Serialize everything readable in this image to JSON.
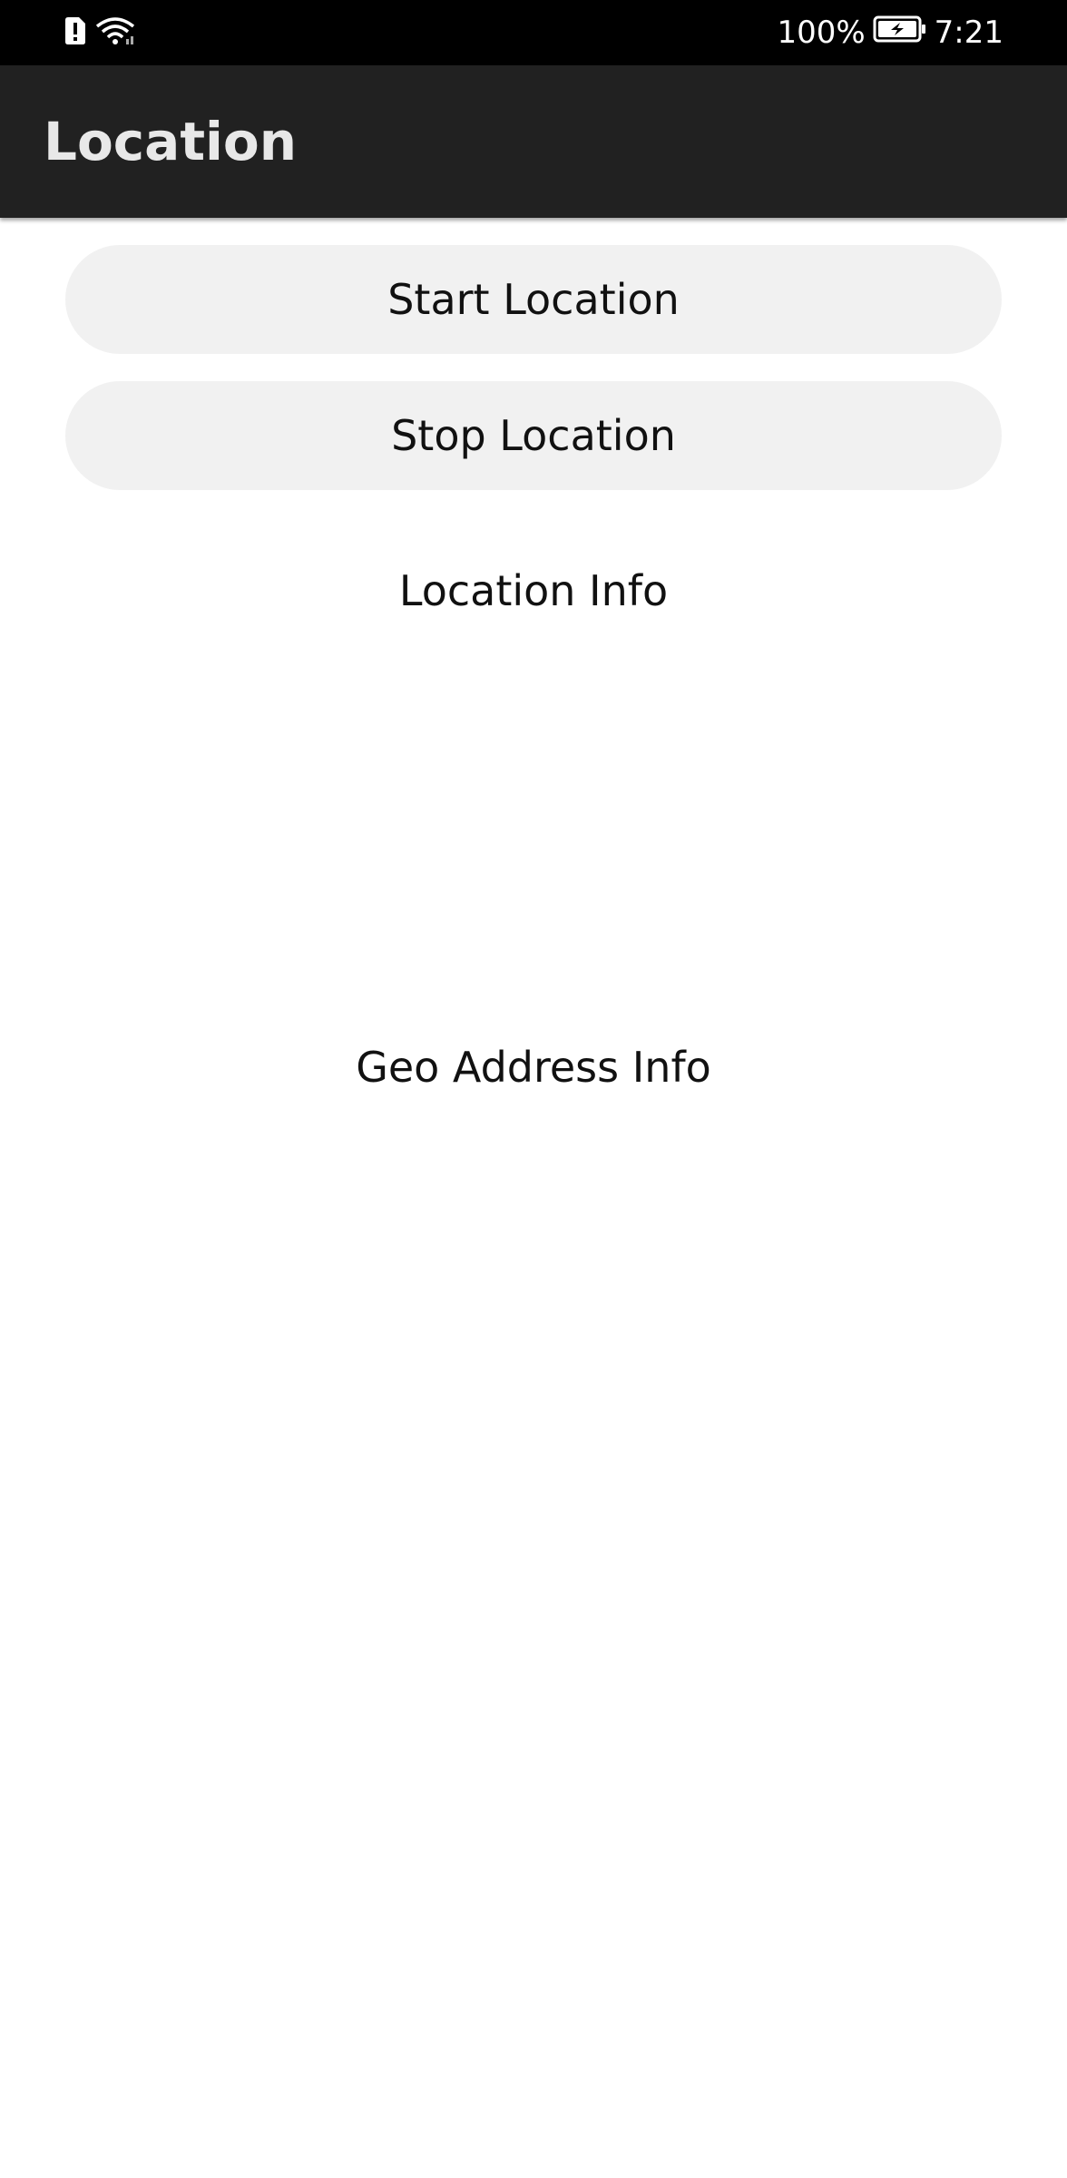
{
  "status_bar": {
    "battery_percent": "100%",
    "time": "7:21",
    "icons": [
      "alert-icon",
      "wifi-icon",
      "battery-charging-icon"
    ]
  },
  "app_bar": {
    "title": "Location"
  },
  "buttons": {
    "start_label": "Start Location",
    "stop_label": "Stop Location"
  },
  "info": {
    "location_label": "Location Info",
    "geo_label": "Geo Address Info"
  },
  "colors": {
    "status_bar": "#000000",
    "app_bar": "#212121",
    "button_bg": "#f1f1f1",
    "background": "#ffffff"
  }
}
